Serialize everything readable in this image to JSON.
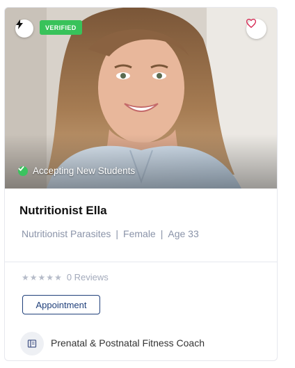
{
  "card": {
    "badge_verified": "VERIFIED",
    "status_text": "Accepting New Students",
    "name": "Nutritionist Ella",
    "meta": {
      "specialty": "Nutritionist Parasites",
      "gender": "Female",
      "age": "Age 33",
      "separator": "|"
    },
    "rating": {
      "stars_filled": 0,
      "stars_total": 5,
      "reviews_label": "0 Reviews"
    },
    "appointment_label": "Appointment",
    "coach_title": "Prenatal & Postnatal Fitness Coach",
    "icons": {
      "top_left": "bolt-icon",
      "top_right": "heart-icon",
      "status": "check-icon",
      "coach": "book-icon"
    },
    "colors": {
      "verified_badge": "#38c25a",
      "heart": "#d7325a",
      "appointment_border": "#1f3f7a",
      "meta_text": "#8a93a8"
    }
  }
}
